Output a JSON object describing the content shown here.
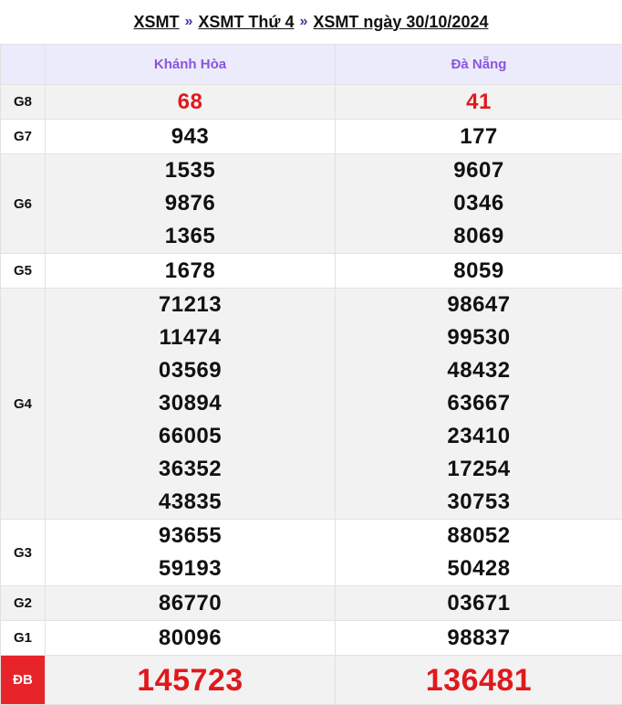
{
  "breadcrumb": {
    "items": [
      "XSMT",
      "XSMT Thứ 4",
      "XSMT ngày 30/10/2024"
    ],
    "separator": "»"
  },
  "columns": [
    "",
    "Khánh Hòa",
    "Đà Nẵng"
  ],
  "prizes": [
    {
      "label": "G8",
      "khanh_hoa": [
        "68"
      ],
      "da_nang": [
        "41"
      ]
    },
    {
      "label": "G7",
      "khanh_hoa": [
        "943"
      ],
      "da_nang": [
        "177"
      ]
    },
    {
      "label": "G6",
      "khanh_hoa": [
        "1535",
        "9876",
        "1365"
      ],
      "da_nang": [
        "9607",
        "0346",
        "8069"
      ]
    },
    {
      "label": "G5",
      "khanh_hoa": [
        "1678"
      ],
      "da_nang": [
        "8059"
      ]
    },
    {
      "label": "G4",
      "khanh_hoa": [
        "71213",
        "11474",
        "03569",
        "30894",
        "66005",
        "36352",
        "43835"
      ],
      "da_nang": [
        "98647",
        "99530",
        "48432",
        "63667",
        "23410",
        "17254",
        "30753"
      ]
    },
    {
      "label": "G3",
      "khanh_hoa": [
        "93655",
        "59193"
      ],
      "da_nang": [
        "88052",
        "50428"
      ]
    },
    {
      "label": "G2",
      "khanh_hoa": [
        "86770"
      ],
      "da_nang": [
        "03671"
      ]
    },
    {
      "label": "G1",
      "khanh_hoa": [
        "80096"
      ],
      "da_nang": [
        "98837"
      ]
    },
    {
      "label": "ĐB",
      "khanh_hoa": [
        "145723"
      ],
      "da_nang": [
        "136481"
      ]
    }
  ],
  "colors": {
    "header_bg": "#ecebfb",
    "header_text": "#8a55e0",
    "highlight_red": "#e0191d",
    "special_label_bg": "#e8242b",
    "row_shade": "#f2f2f2"
  }
}
